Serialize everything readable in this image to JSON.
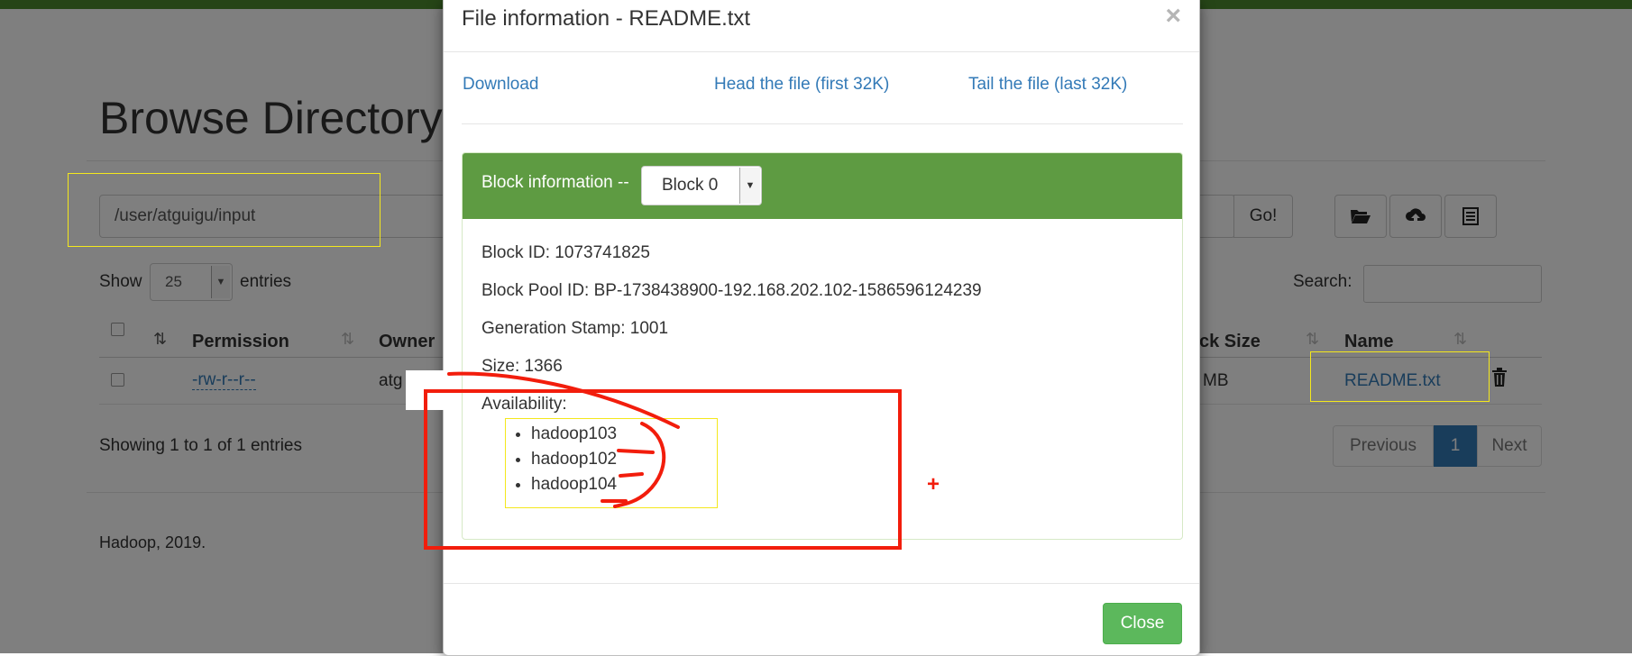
{
  "background": {
    "page_title": "Browse Directory",
    "path_value": "/user/atguigu/input",
    "go_label": "Go!",
    "show_label": "Show",
    "entries_value": "25",
    "entries_label": "entries",
    "search_label": "Search:",
    "columns": {
      "permission": "Permission",
      "owner": "Owner",
      "block_size_partial": "ck Size",
      "name": "Name"
    },
    "row": {
      "permission": "-rw-r--r--",
      "owner_partial": "atg",
      "block_size_partial": "MB",
      "name": "README.txt"
    },
    "showing_text": "Showing 1 to 1 of 1 entries",
    "pager": {
      "previous": "Previous",
      "current": "1",
      "next": "Next"
    },
    "footer": "Hadoop, 2019.",
    "icons": [
      "folder-open-icon",
      "cloud-upload-icon",
      "list-icon",
      "trash-icon"
    ]
  },
  "modal": {
    "title": "File information - README.txt",
    "close_x": "×",
    "links": {
      "download": "Download",
      "head": "Head the file (first 32K)",
      "tail": "Tail the file (last 32K)"
    },
    "block_info_label": "Block information --",
    "block_select": "Block 0",
    "block_id": "Block ID: 1073741825",
    "block_pool_id": "Block Pool ID: BP-1738438900-192.168.202.102-1586596124239",
    "generation_stamp": "Generation Stamp: 1001",
    "size": "Size: 1366",
    "availability_label": "Availability:",
    "hosts": [
      "hadoop103",
      "hadoop102",
      "hadoop104"
    ],
    "close_button": "Close"
  },
  "annotations": {
    "plus": "+",
    "colors": {
      "yellow": "#f4e81c",
      "red": "#f21d0c"
    }
  },
  "colors": {
    "header_green": "#4c8a2f",
    "panel_green": "#5e9b42",
    "link_blue": "#337ab7",
    "close_green": "#5cb85c"
  }
}
